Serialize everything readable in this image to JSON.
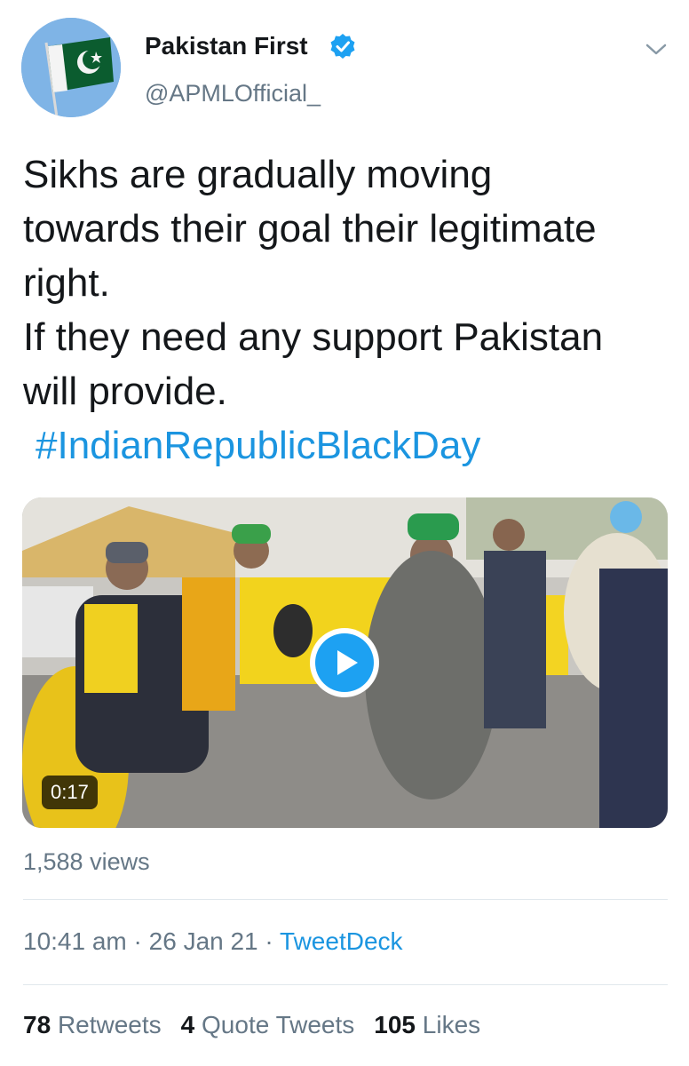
{
  "author": {
    "name": "Pakistan First",
    "handle": "@APMLOfficial_",
    "verified": true,
    "avatar_icon": "pakistan-flag-avatar"
  },
  "tweet": {
    "lines": [
      "Sikhs are gradually moving",
      "towards their goal their legitimate",
      "right.",
      "If they need any support Pakistan",
      "will provide."
    ],
    "hashtag": "#IndianRepublicBlackDay"
  },
  "media": {
    "type": "video",
    "duration": "0:17",
    "play_icon": "play-icon",
    "views": "1,588 views"
  },
  "meta": {
    "time": "10:41 am",
    "separator": " · ",
    "date": "26 Jan 21",
    "source": "TweetDeck"
  },
  "stats": {
    "retweets_count": "78",
    "retweets_label": "Retweets",
    "quotes_count": "4",
    "quotes_label": "Quote Tweets",
    "likes_count": "105",
    "likes_label": "Likes"
  },
  "colors": {
    "link": "#1b95e0",
    "secondary_text": "#657786",
    "primary_text": "#14171a",
    "verified_badge": "#1da1f2",
    "divider": "#e1e8ed"
  }
}
